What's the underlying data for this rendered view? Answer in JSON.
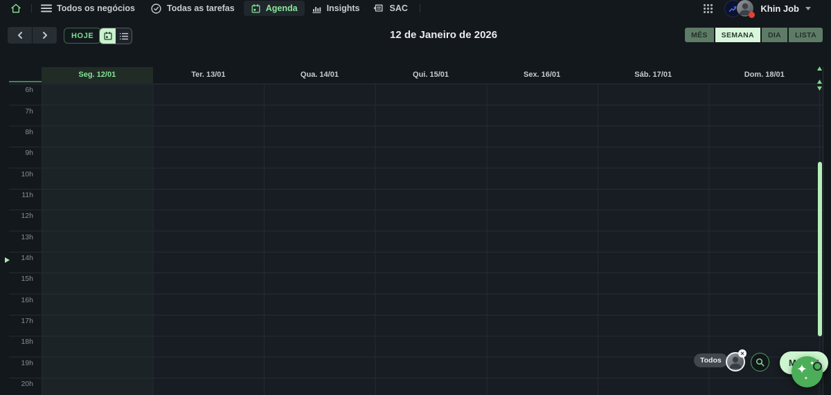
{
  "topbar": {
    "nav_deals": "Todos os negócios",
    "nav_tasks": "Todas as tarefas",
    "nav_agenda": "Agenda",
    "nav_insights": "Insights",
    "nav_sac": "SAC",
    "user_name": "Khin Job"
  },
  "toolbar": {
    "today": "HOJE",
    "title": "12 de Janeiro de 2026",
    "view_month": "MÊS",
    "view_week": "SEMANA",
    "view_day": "DIA",
    "view_list": "LISTA",
    "active_view": "SEMANA"
  },
  "calendar": {
    "days": [
      {
        "label": "Seg. 12/01",
        "today": true
      },
      {
        "label": "Ter. 13/01"
      },
      {
        "label": "Qua. 14/01"
      },
      {
        "label": "Qui. 15/01"
      },
      {
        "label": "Sex. 16/01"
      },
      {
        "label": "Sáb. 17/01"
      },
      {
        "label": "Dom. 18/01"
      }
    ],
    "hours": [
      "6h",
      "7h",
      "8h",
      "9h",
      "10h",
      "11h",
      "12h",
      "13h",
      "14h",
      "15h",
      "16h",
      "17h",
      "18h",
      "19h",
      "20h"
    ]
  },
  "overlay": {
    "filter": "Todos",
    "close": "×",
    "menu": "MENU"
  },
  "colors": {
    "accent_green": "#8be698",
    "today_header_bg": "#212c27",
    "active_view_bg": "#d9f6db",
    "inactive_view_bg": "#5e7b66",
    "menu_pill_bg": "#cdf6d0",
    "fab_green": "#4cae58",
    "scrollbar_thumb": "#b4efb8",
    "notification_red": "#e8402f",
    "background": "#13181d"
  }
}
